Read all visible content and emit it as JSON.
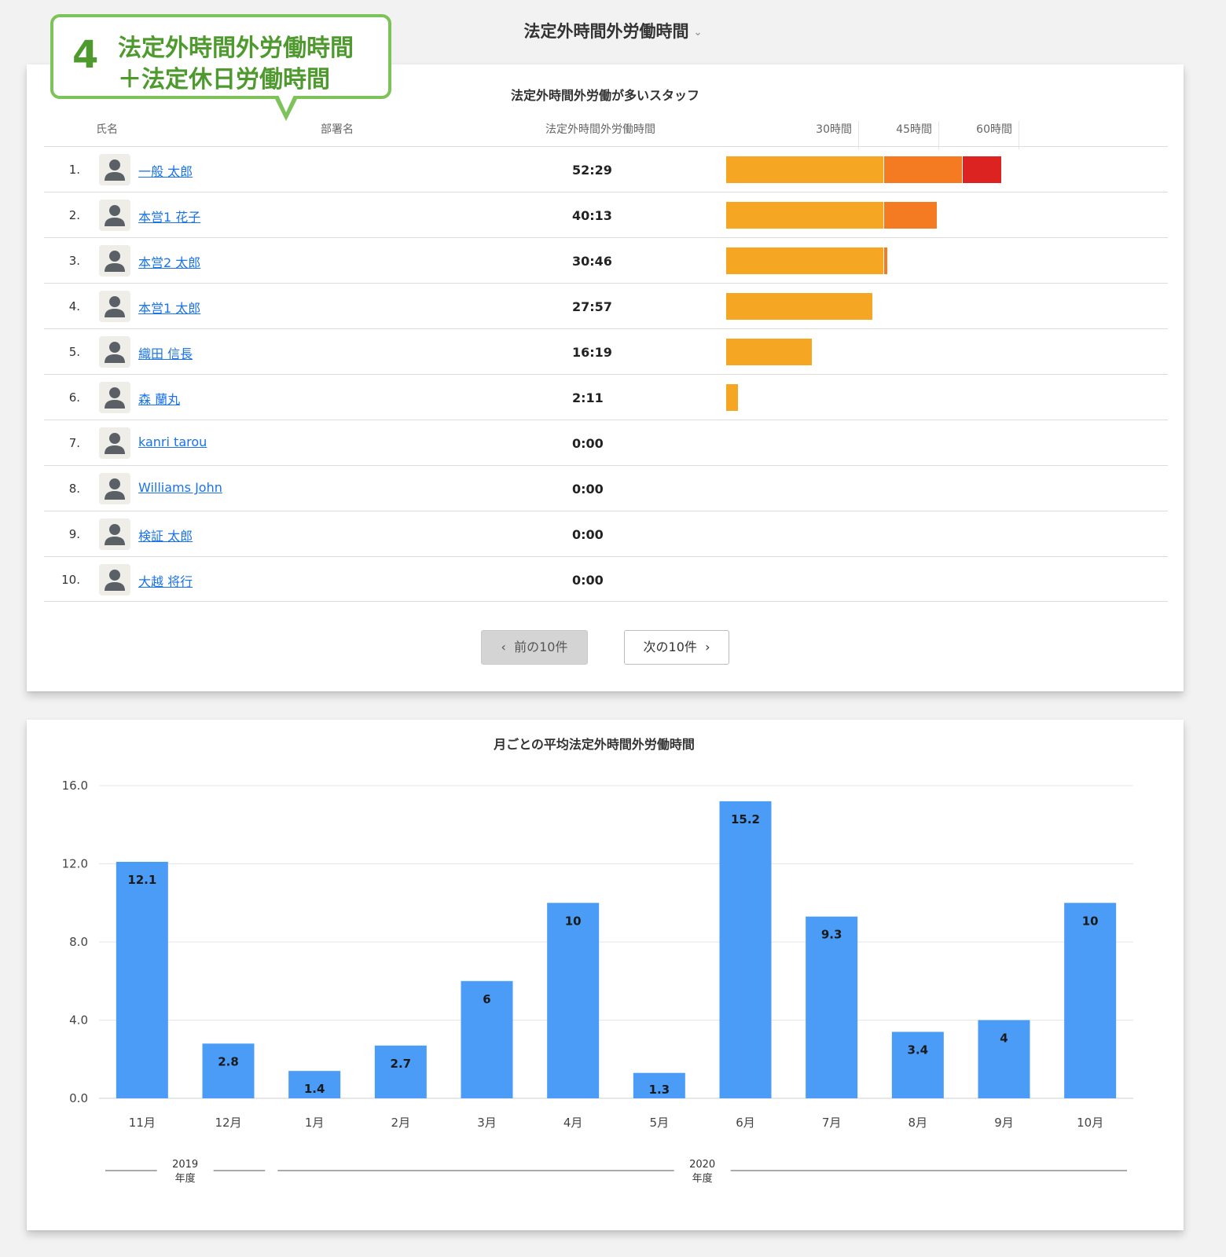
{
  "header": {
    "dropdown_title": "法定外時間外労働時間",
    "chevron": "⌄"
  },
  "callout": {
    "number": "4",
    "line1": "法定外時間外労働時間",
    "line2": "＋法定休日労働時間"
  },
  "staff_panel": {
    "title": "法定外時間外労働が多いスタッフ",
    "columns": {
      "name": "氏名",
      "department": "部署名",
      "hours": "法定外時間外労働時間"
    },
    "thresholds": [
      {
        "label": "30時間",
        "hours": 30
      },
      {
        "label": "45時間",
        "hours": 45
      },
      {
        "label": "60時間",
        "hours": 60
      }
    ],
    "colors": {
      "under30": "#f5a623",
      "under45": "#f47b22",
      "over60": "#dd2222",
      "link": "#1a73e8"
    },
    "rows": [
      {
        "rank": "1.",
        "name": "一般 太郎",
        "department": "",
        "time": "52:29",
        "hours": 52.48
      },
      {
        "rank": "2.",
        "name": "本営1 花子",
        "department": "",
        "time": "40:13",
        "hours": 40.22
      },
      {
        "rank": "3.",
        "name": "本営2 太郎",
        "department": "",
        "time": "30:46",
        "hours": 30.77
      },
      {
        "rank": "4.",
        "name": "本営1 太郎",
        "department": "",
        "time": "27:57",
        "hours": 27.95
      },
      {
        "rank": "5.",
        "name": "織田 信長",
        "department": "",
        "time": "16:19",
        "hours": 16.32
      },
      {
        "rank": "6.",
        "name": "森 蘭丸",
        "department": "",
        "time": "2:11",
        "hours": 2.18
      },
      {
        "rank": "7.",
        "name": "kanri tarou",
        "department": "",
        "time": "0:00",
        "hours": 0
      },
      {
        "rank": "8.",
        "name": "Williams John",
        "department": "",
        "time": "0:00",
        "hours": 0
      },
      {
        "rank": "9.",
        "name": "検証 太郎",
        "department": "",
        "time": "0:00",
        "hours": 0
      },
      {
        "rank": "10.",
        "name": "大越 将行",
        "department": "",
        "time": "0:00",
        "hours": 0
      }
    ],
    "pager": {
      "prev_label": "前の10件",
      "next_label": "次の10件",
      "prev_icon": "‹",
      "next_icon": "›"
    }
  },
  "chart_data": {
    "type": "bar",
    "title": "月ごとの平均法定外時間外労働時間",
    "xlabel": "",
    "ylabel": "",
    "categories": [
      "11月",
      "12月",
      "1月",
      "2月",
      "3月",
      "4月",
      "5月",
      "6月",
      "7月",
      "8月",
      "9月",
      "10月"
    ],
    "values": [
      12.1,
      2.8,
      1.4,
      2.7,
      6,
      10,
      1.3,
      15.2,
      9.3,
      3.4,
      4,
      10
    ],
    "data_labels": [
      "12.1",
      "2.8",
      "1.4",
      "2.7",
      "6",
      "10",
      "1.3",
      "15.2",
      "9.3",
      "3.4",
      "4",
      "10"
    ],
    "ylim": [
      0,
      16
    ],
    "yticks": [
      "0.0",
      "4.0",
      "8.0",
      "12.0",
      "16.0"
    ],
    "grid": true,
    "legend": "none",
    "bar_color": "#4a9cf7",
    "groups": [
      {
        "year": "2019",
        "unit": "年度",
        "from": 0,
        "to": 1
      },
      {
        "year": "2020",
        "unit": "年度",
        "from": 2,
        "to": 11
      }
    ]
  }
}
